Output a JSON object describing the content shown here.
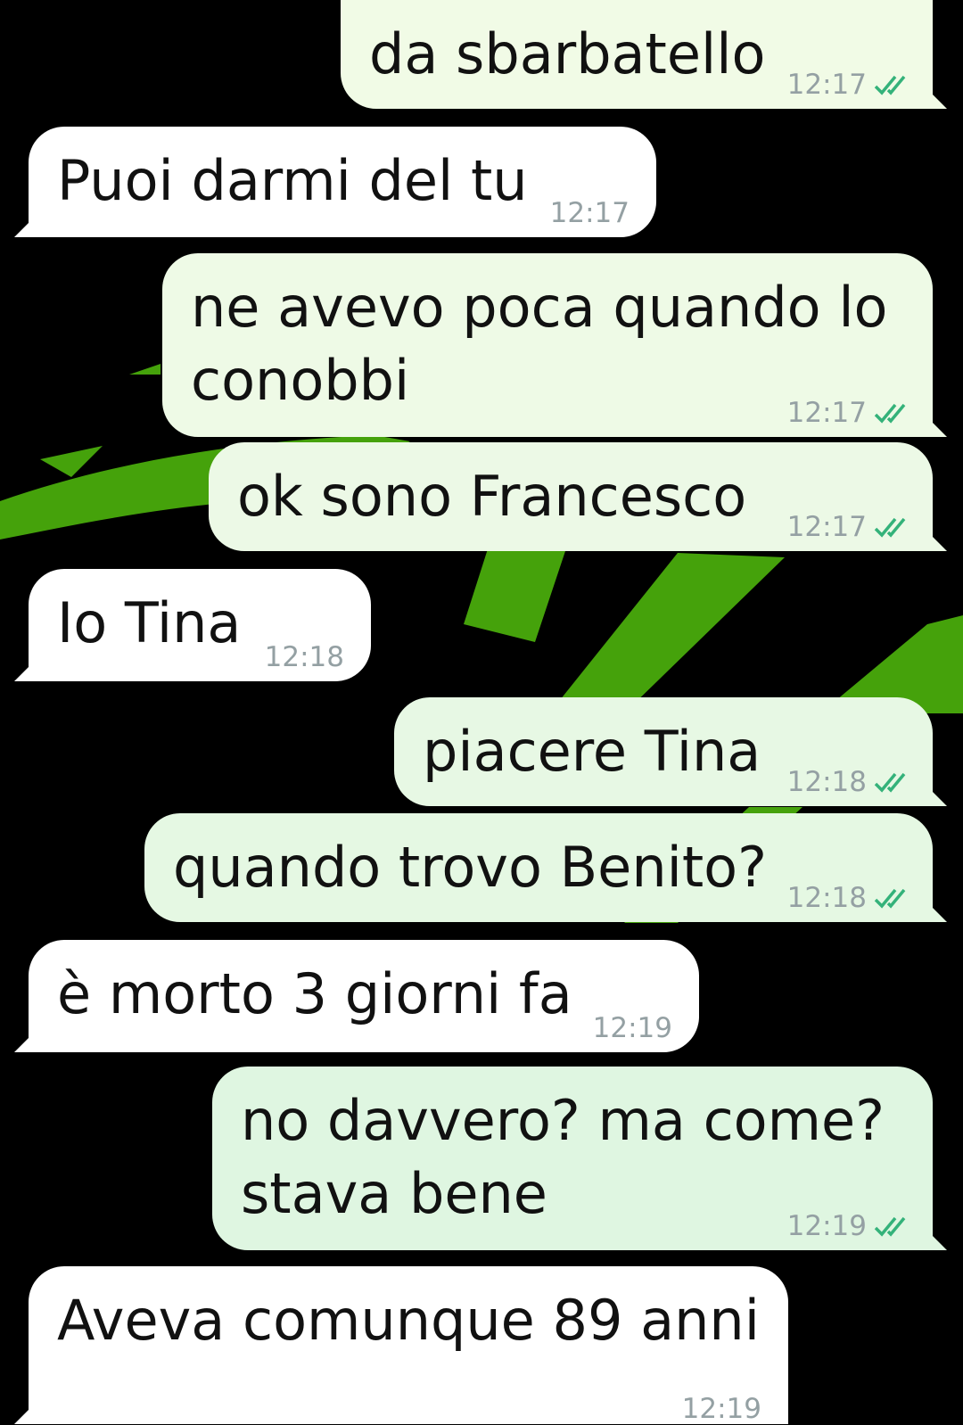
{
  "theme": {
    "background": "#000000",
    "wallpaper_green": "#45a20b",
    "outgoing_bubble_top": "#f1fbe6",
    "outgoing_bubble_bottom": "#dff6e1",
    "incoming_bubble": "#ffffff",
    "text_color": "#111111",
    "time_color": "#94a0a3",
    "read_tick_color": "#34b27a"
  },
  "messages": [
    {
      "direction": "out",
      "text": "da sbarbatello",
      "time": "12:17",
      "status_icon": "double-check-icon",
      "bubble_color": "#f1fbe6"
    },
    {
      "direction": "in",
      "text": "Puoi darmi del tu",
      "time": "12:17"
    },
    {
      "direction": "out",
      "text": "ne avevo poca quando lo\nconobbi",
      "time": "12:17",
      "status_icon": "double-check-icon",
      "bubble_color": "#eefae6"
    },
    {
      "direction": "out",
      "text": "ok sono Francesco",
      "time": "12:17",
      "status_icon": "double-check-icon",
      "bubble_color": "#ecf9e6"
    },
    {
      "direction": "in",
      "text": "Io Tina",
      "time": "12:18"
    },
    {
      "direction": "out",
      "text": "piacere Tina",
      "time": "12:18",
      "status_icon": "double-check-icon",
      "bubble_color": "#e7f8e4"
    },
    {
      "direction": "out",
      "text": "quando trovo Benito?",
      "time": "12:18",
      "status_icon": "double-check-icon",
      "bubble_color": "#e5f8e3"
    },
    {
      "direction": "in",
      "text": "è morto 3 giorni fa",
      "time": "12:19"
    },
    {
      "direction": "out",
      "text": "no davvero? ma come?\nstava bene",
      "time": "12:19",
      "status_icon": "double-check-icon",
      "bubble_color": "#dff6e1"
    },
    {
      "direction": "in",
      "text": "Aveva comunque 89 anni",
      "time": "12:19"
    }
  ]
}
